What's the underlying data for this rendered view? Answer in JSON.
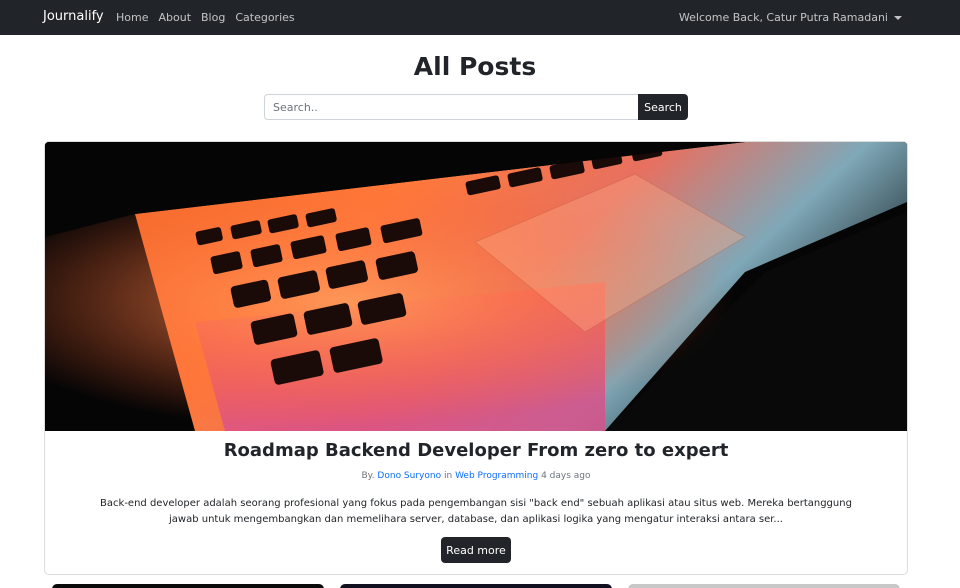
{
  "navbar": {
    "brand": "Journalify",
    "links": [
      "Home",
      "About",
      "Blog",
      "Categories"
    ],
    "user_menu": "Welcome Back, Catur Putra Ramadani"
  },
  "page_title": "All Posts",
  "search": {
    "placeholder": "Search..",
    "button_label": "Search"
  },
  "post": {
    "title": "Roadmap Backend Developer From zero to expert",
    "by_label": "By.",
    "author": "Dono Suryono",
    "in_label": "in",
    "category": "Web Programming",
    "time": "4 days ago",
    "excerpt": "Back-end developer adalah seorang profesional yang fokus pada pengembangan sisi \"back end\" sebuah aplikasi atau situs web. Mereka bertanggung jawab untuk mengembangkan dan memelihara server, database, dan aplikasi logika yang mengatur interaksi antara ser...",
    "read_more_label": "Read more"
  },
  "colors": {
    "navbar_bg": "#212529",
    "link": "#0d6efd",
    "button_bg": "#212529"
  }
}
